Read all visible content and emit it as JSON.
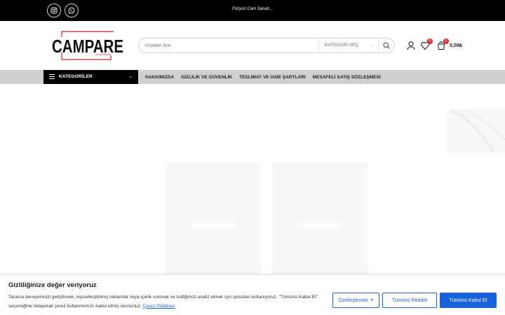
{
  "topbar": {
    "tagline": "Füzyon Cam Sanatı..."
  },
  "header": {
    "logo_text": "CAMPARE",
    "logo_subtext": "GLASSWARE",
    "search": {
      "placeholder": "Ürünleri Ara",
      "category_label": "KATEGORİ SEÇ"
    },
    "wishlist_count": "0",
    "cart_count": "0",
    "cart_total": "0,00₺"
  },
  "nav": {
    "categories_label": "KATEGORİLER",
    "links": [
      "HAKKIMIZDA",
      "GİZLİLİK VE GÜVENLİK",
      "TESLİMAT VE İADE ŞARTLARI",
      "MESAFELİ SATIŞ SÖZLEŞMESİ"
    ]
  },
  "cookie": {
    "title": "Gizliliğinize değer veriyoruz",
    "text": "Tarama deneyiminizi geliştirmek, kişiselleştirilmiş reklamlar veya içerik sunmak ve trafiğimizi analiz etmek için çerezleri kullanıyoruz. \"Tümünü Kabul Et\" seçeneğine tıklayarak çerez kullanımımızı kabul etmiş olursunuz.",
    "policy_link": "Çerez Politikası",
    "customize_label": "Özelleştirmek",
    "reject_label": "Tümünü Reddet",
    "accept_label": "Tümünü Kabul Et"
  },
  "colors": {
    "accent": "#1863dc",
    "badge": "#e02424",
    "logo_red": "#c8202f",
    "topbar": "#000000",
    "navbar": "#cfcfcf"
  },
  "icons": [
    "instagram-icon",
    "whatsapp-icon",
    "search-icon",
    "user-icon",
    "heart-icon",
    "cart-icon",
    "menu-icon",
    "chevron-down-icon"
  ]
}
